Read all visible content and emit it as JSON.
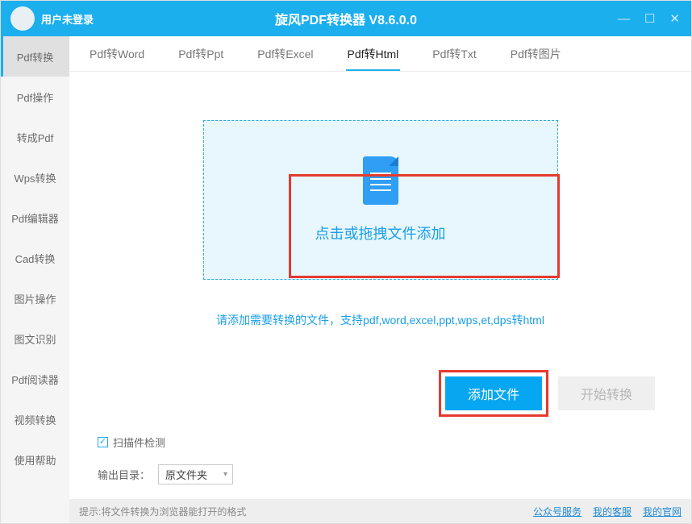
{
  "titlebar": {
    "user_status": "用户未登录",
    "app_title": "旋风PDF转换器 V8.6.0.0"
  },
  "sidebar": {
    "items": [
      {
        "label": "Pdf转换"
      },
      {
        "label": "Pdf操作"
      },
      {
        "label": "转成Pdf"
      },
      {
        "label": "Wps转换"
      },
      {
        "label": "Pdf编辑器"
      },
      {
        "label": "Cad转换"
      },
      {
        "label": "图片操作"
      },
      {
        "label": "图文识别"
      },
      {
        "label": "Pdf阅读器"
      },
      {
        "label": "视频转换"
      },
      {
        "label": "使用帮助"
      }
    ],
    "active_index": 0
  },
  "tabs": {
    "items": [
      {
        "label": "Pdf转Word"
      },
      {
        "label": "Pdf转Ppt"
      },
      {
        "label": "Pdf转Excel"
      },
      {
        "label": "Pdf转Html"
      },
      {
        "label": "Pdf转Txt"
      },
      {
        "label": "Pdf转图片"
      }
    ],
    "active_index": 3
  },
  "dropzone": {
    "text": "点击或拖拽文件添加"
  },
  "hint": "请添加需要转换的文件，支持pdf,word,excel,ppt,wps,et,dps转html",
  "buttons": {
    "add": "添加文件",
    "start": "开始转换"
  },
  "options": {
    "scan_detect": "扫描件检测",
    "output_label": "输出目录：",
    "output_value": "原文件夹"
  },
  "footer": {
    "tip": "提示:将文件转换为浏览器能打开的格式",
    "links": [
      {
        "label": "公众号服务"
      },
      {
        "label": "我的客服"
      },
      {
        "label": "我的官网"
      }
    ]
  }
}
